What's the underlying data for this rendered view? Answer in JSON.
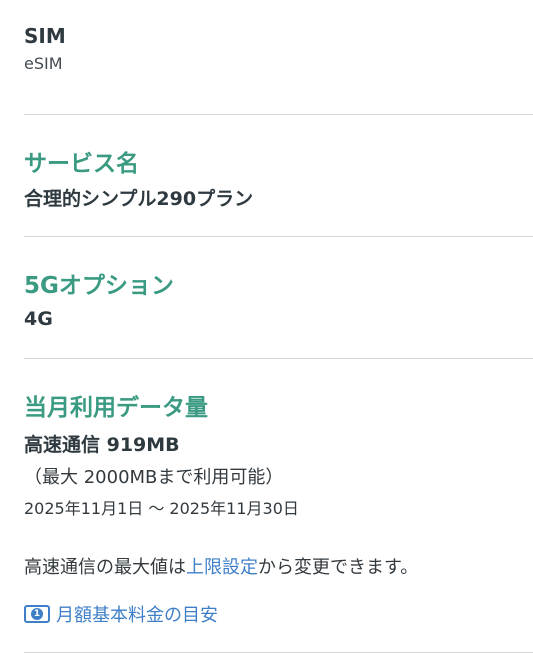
{
  "sim": {
    "title": "SIM",
    "value": "eSIM"
  },
  "service": {
    "title": "サービス名",
    "value": "合理的シンプル290プラン"
  },
  "option5g": {
    "title": "5Gオプション",
    "value": "4G"
  },
  "usage": {
    "title": "当月利用データ量",
    "used": "高速通信 919MB",
    "limit": "（最大 2000MBまで利用可能）",
    "period": "2025年11月1日 ～ 2025年11月30日",
    "note_prefix": "高速通信の最大値は",
    "note_link": "上限設定",
    "note_suffix": "から変更できます。",
    "fee_link": "月額基本料金の目安"
  },
  "colors": {
    "accent": "#3a9a82",
    "link": "#3f7fc7",
    "divider": "#d6d6d6"
  },
  "icons": {
    "fee_icon": "money-bill-icon"
  }
}
